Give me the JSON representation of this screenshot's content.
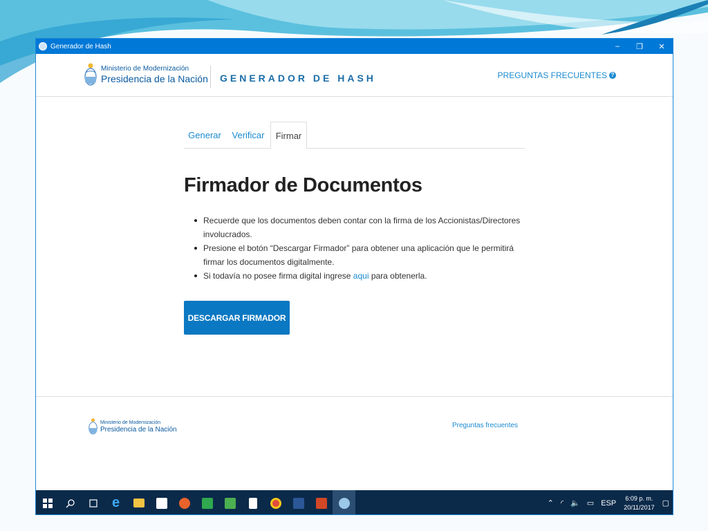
{
  "window": {
    "title": "Generador de Hash",
    "controls": {
      "minimize": "–",
      "restore": "❐",
      "close": "✕"
    }
  },
  "header": {
    "org_line1": "Ministerio de Modernización",
    "org_line2": "Presidencia de la Nación",
    "app_name": "GENERADOR DE HASH",
    "faq_label": "PREGUNTAS FRECUENTES"
  },
  "tabs": [
    {
      "label": "Generar",
      "active": false
    },
    {
      "label": "Verificar",
      "active": false
    },
    {
      "label": "Firmar",
      "active": true
    }
  ],
  "main": {
    "title": "Firmador de Documentos",
    "bullets": [
      "Recuerde que los documentos deben contar con la firma de los Accionistas/Directores involucrados.",
      "Presione el botón “Descargar Firmador” para obtener una aplicación que le permitirá firmar los documentos digitalmente."
    ],
    "bullet3_before": "Si todavía no posee firma digital ingrese ",
    "bullet3_link": "aqui",
    "bullet3_after": " para obtenerla.",
    "download_button": "DESCARGAR FIRMADOR"
  },
  "footer": {
    "org_line1": "Ministerio de Modernización",
    "org_line2": "Presidencia de la Nación",
    "faq_link": "Preguntas frecuentes"
  },
  "taskbar": {
    "language": "ESP",
    "time": "6:09 p. m.",
    "date": "20/11/2017"
  },
  "colors": {
    "accent": "#0a78c2",
    "link": "#1a8ad0",
    "titlebar": "#0078d7",
    "taskbar": "#0b2a4a"
  }
}
